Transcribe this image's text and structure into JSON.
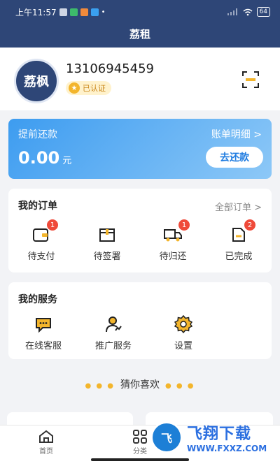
{
  "status": {
    "time": "上午11:57",
    "battery": "64"
  },
  "header": {
    "title": "荔租"
  },
  "profile": {
    "avatar_text": "荔枫",
    "phone": "13106945459",
    "verified": "已认证"
  },
  "repay": {
    "label": "提前还款",
    "bill_link": "账单明细 >",
    "amount": "0.00",
    "unit": "元",
    "button": "去还款"
  },
  "orders": {
    "title": "我的订单",
    "all": "全部订单 >",
    "items": [
      {
        "label": "待支付",
        "badge": "1"
      },
      {
        "label": "待签署",
        "badge": ""
      },
      {
        "label": "待归还",
        "badge": "1"
      },
      {
        "label": "已完成",
        "badge": "2"
      }
    ]
  },
  "services": {
    "title": "我的服务",
    "items": [
      {
        "label": "在线客服"
      },
      {
        "label": "推广服务"
      },
      {
        "label": "设置"
      }
    ]
  },
  "guess": {
    "label": "猜你喜欢"
  },
  "tabbar": {
    "items": [
      {
        "label": "首页"
      },
      {
        "label": "分类"
      }
    ]
  },
  "watermark": {
    "logo": "飞",
    "title": "飞翔下载",
    "url": "WWW.FXXZ.COM"
  },
  "colors": {
    "header": "#2e4677",
    "accent": "#1f7ce0",
    "badge": "#ef4a3a",
    "gold": "#f3b52c"
  }
}
